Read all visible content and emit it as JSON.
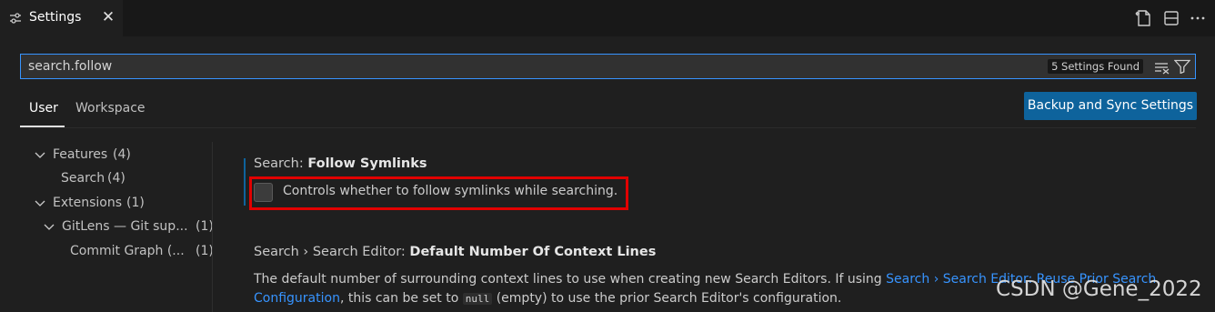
{
  "tab": {
    "title": "Settings",
    "close_glyph": "✕",
    "icon": "settings-sliders-icon"
  },
  "editor_actions": [
    "open-settings-json-icon",
    "split-editor-icon",
    "more-actions-icon"
  ],
  "search": {
    "value": "search.follow",
    "result_count": "5 Settings Found",
    "clear_icon": "clear-filter-icon",
    "filter_icon": "filter-icon"
  },
  "scopes": {
    "user": "User",
    "workspace": "Workspace",
    "active": "User"
  },
  "sync_button": "Backup and Sync Settings",
  "toc": [
    {
      "label": "Features",
      "count": "(4)",
      "expanded": true
    },
    {
      "label": "Search",
      "count": "(4)"
    },
    {
      "label": "Extensions",
      "count": "(1)",
      "expanded": true
    },
    {
      "label": "GitLens — Git sup...",
      "count": "(1)",
      "expanded": true
    },
    {
      "label": "Commit Graph (...",
      "count": "(1)"
    }
  ],
  "settings": [
    {
      "category": "Search: ",
      "name": "Follow Symlinks",
      "checkbox_label": "Controls whether to follow symlinks while searching.",
      "checked": false
    },
    {
      "category": "Search › Search Editor: ",
      "name": "Default Number Of Context Lines",
      "desc_1a": "The default number of surrounding context lines to use when creating new Search Editors. If using ",
      "desc_1link": "Search › Search Editor: Reuse Prior Search",
      "desc_2link": "Configuration",
      "desc_2a": ", this can be set to ",
      "desc_2code": "null",
      "desc_2b": " (empty) to use the prior Search Editor's configuration."
    }
  ],
  "watermark": "CSDN @Gene_2022",
  "colors": {
    "accent": "#3794ff",
    "button": "#0e639c",
    "highlight": "#e10000",
    "background": "#1f1f1f"
  }
}
